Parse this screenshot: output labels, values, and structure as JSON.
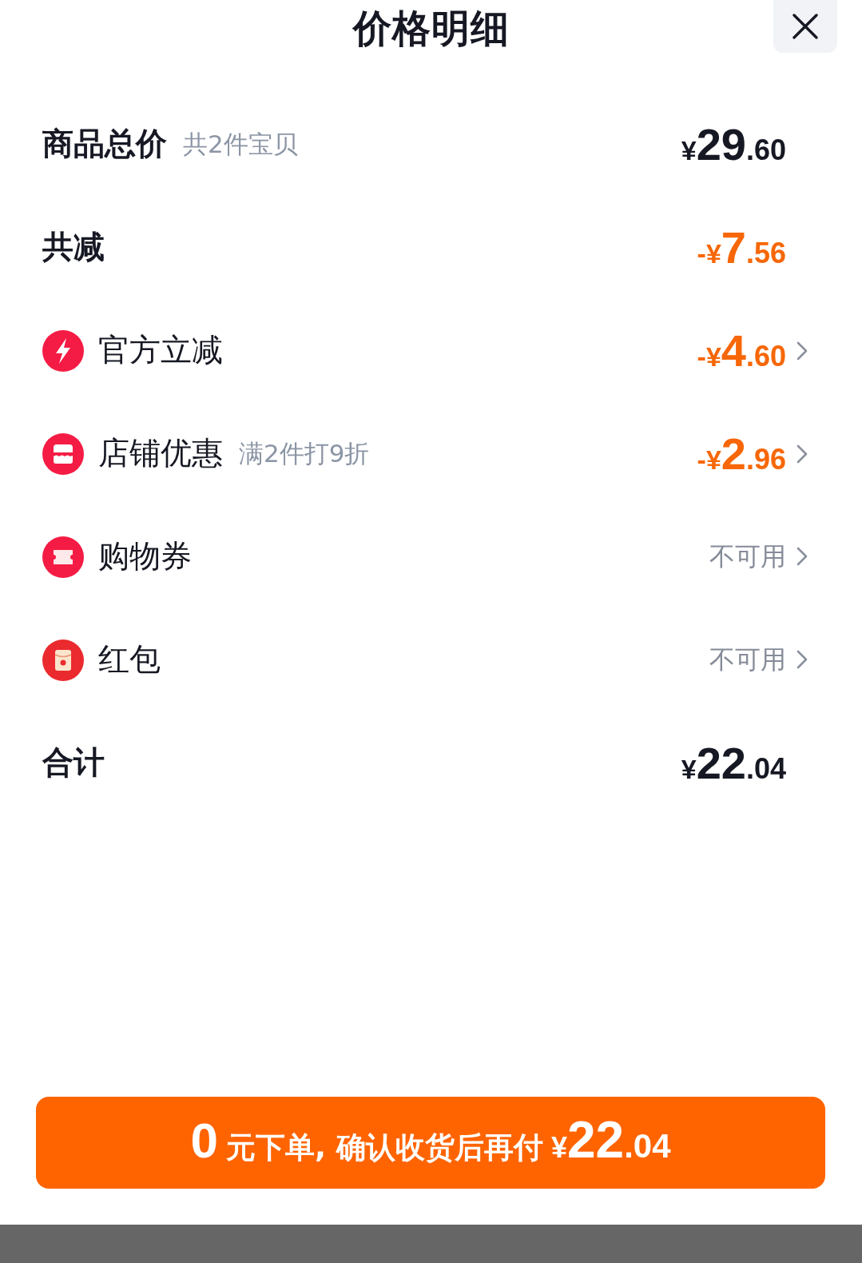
{
  "header": {
    "title": "价格明细"
  },
  "rows": [
    {
      "kind": "summary",
      "label": "商品总价",
      "note": "共2件宝贝",
      "amount": {
        "prefix": "¥",
        "integer": "29",
        "decimal": ".60",
        "discount": false
      }
    },
    {
      "kind": "summary",
      "label": "共减",
      "amount": {
        "prefix": "-¥",
        "integer": "7",
        "decimal": ".56",
        "discount": true
      }
    },
    {
      "kind": "detail",
      "label": "官方立减",
      "amount": {
        "prefix": "-¥",
        "integer": "4",
        "decimal": ".60",
        "discount": true
      }
    },
    {
      "kind": "detail",
      "label": "店铺优惠",
      "note": "满2件打9折",
      "amount": {
        "prefix": "-¥",
        "integer": "2",
        "decimal": ".96",
        "discount": true
      }
    },
    {
      "kind": "detail",
      "label": "购物券",
      "status": "不可用"
    },
    {
      "kind": "detail",
      "label": "红包",
      "status": "不可用"
    },
    {
      "kind": "summary",
      "label": "合计",
      "amount": {
        "prefix": "¥",
        "integer": "22",
        "decimal": ".04",
        "discount": false
      }
    }
  ],
  "checkout_button": {
    "lead": "0",
    "text": "元下单, 确认收货后再付",
    "amount": {
      "prefix": "¥",
      "integer": "22",
      "decimal": ".04"
    }
  }
}
